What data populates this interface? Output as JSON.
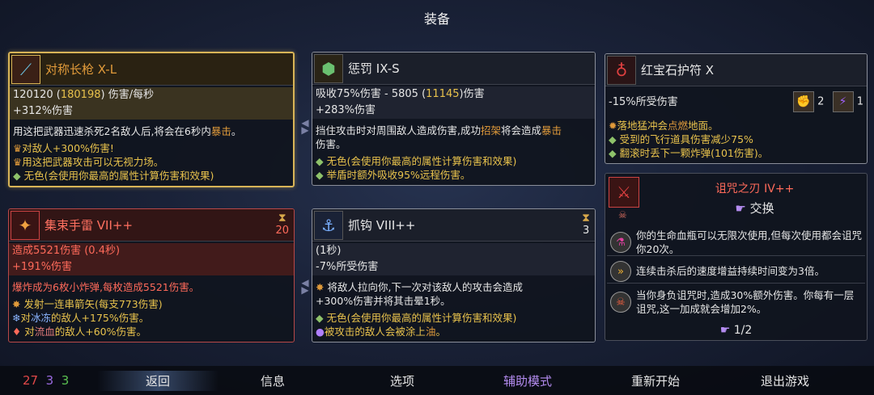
{
  "page_title": "装备",
  "weapon1": {
    "name": "对称长枪 X-L",
    "dps": "120120",
    "dps_max": "180198",
    "dps_unit": "伤害/每秒",
    "bonus": "+312%伤害",
    "desc": [
      "用这把武器迅速杀死2名敌人后,将会在6秒内",
      "暴击",
      "。"
    ],
    "line2": "对敌人+300%伤害!",
    "line3": "用这把武器攻击可以无视力场。",
    "line4": "无色(会使用你最高的属性计算伤害和效果)"
  },
  "shield": {
    "name": "惩罚 IX-S",
    "stat": "吸收75%伤害 - 5805",
    "stat_max": "11145",
    "stat_unit": "伤害",
    "bonus": "+283%伤害",
    "desc_a": "挡住攻击时对周围敌人造成伤害,成功",
    "desc_parry": "招架",
    "desc_b": "将会造成",
    "desc_crit": "暴击",
    "desc_c": "伤害。",
    "line2": "无色(会使用你最高的属性计算伤害和效果)",
    "line3": "举盾时额外吸收95%远程伤害。"
  },
  "amulet": {
    "name": "红宝石护符 X",
    "stat": "-15%所受伤害",
    "count1": "2",
    "count2": "1",
    "line1_a": "落地猛冲会",
    "line1_b": "点燃",
    "line1_c": "地面。",
    "line2": "受到的飞行道具伤害减少75%",
    "line3": "翻滚时丢下一颗炸弹(101伤害)。"
  },
  "grenade": {
    "name": "集束手雷 VII++",
    "cooldown": "20",
    "stat": "造成5521伤害 (0.4秒)",
    "bonus": "+191%伤害",
    "desc": "爆炸成为6枚小炸弹,每枚造成5521伤害。",
    "line2": "发射一连串箭矢(每支773伤害)",
    "line3_a": "对",
    "line3_b": "冰冻",
    "line3_c": "的敌人+175%伤害。",
    "line4_a": "对",
    "line4_b": "流血",
    "line4_c": "的敌人+60%伤害。"
  },
  "hook": {
    "name": "抓钩 VIII++",
    "cooldown": "3",
    "stat": "(1秒)",
    "bonus": "-7%所受伤害",
    "desc": "将敌人拉向你,下一次对该敌人的攻击会造成",
    "desc2": "+300%伤害并将其击晕1秒。",
    "line2": "无色(会使用你最高的属性计算伤害和效果)",
    "line3_a": "被攻击的敌人会被涂上",
    "line3_b": "油",
    "line3_c": "。"
  },
  "curse": {
    "name": "诅咒之刃 IV++",
    "swap": "交换",
    "skill1": "你的生命血瓶可以无限次使用,但每次使用都会诅咒你20次。",
    "skill2": "连续击杀后的速度增益持续时间变为3倍。",
    "skill3": "当你身负诅咒时,造成30%额外伤害。你每有一层诅咒,这一加成就会增加2%。",
    "page": "1/2"
  },
  "stats": {
    "red": "27",
    "purple": "3",
    "green": "3"
  },
  "nav": {
    "back": "返回",
    "info": "信息",
    "options": "选项",
    "assist": "辅助模式",
    "restart": "重新开始",
    "quit": "退出游戏"
  },
  "colors": {
    "gold_border": "#d8b457",
    "red_border": "#b84848",
    "accent_purple": "#b48cf0"
  }
}
